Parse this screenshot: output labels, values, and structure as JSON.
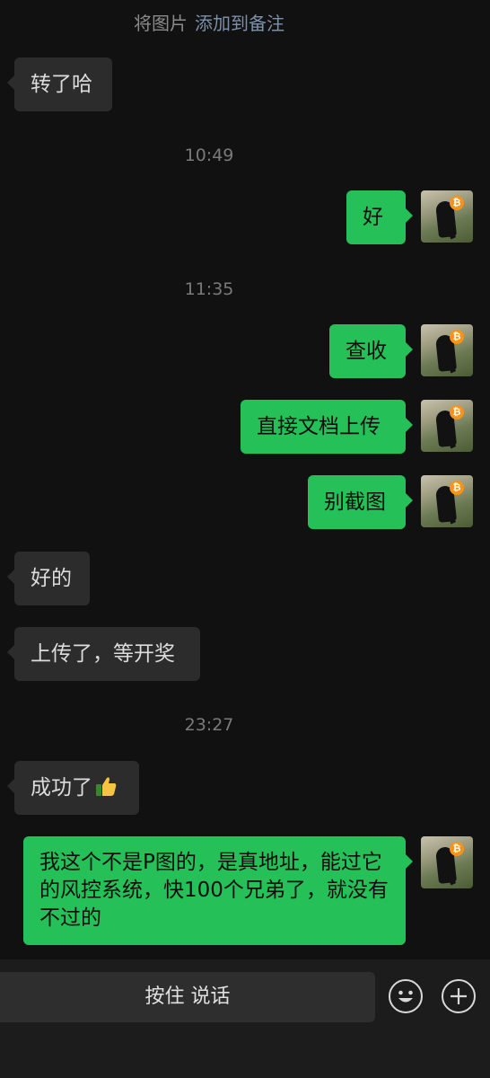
{
  "notice": {
    "text": "将图片",
    "link": "添加到备注"
  },
  "timestamps": [
    "10:49",
    "11:35",
    "23:27"
  ],
  "messages": [
    {
      "text": "转了哈"
    },
    {
      "text": "好"
    },
    {
      "text": "查收"
    },
    {
      "text": "直接文档上传"
    },
    {
      "text": "别截图"
    },
    {
      "text": "好的"
    },
    {
      "text": "上传了，等开奖"
    },
    {
      "text": "成功了"
    },
    {
      "text": "我这个不是P图的，是真地址，能过它的风控系统，快100个兄弟了，就没有不过的"
    }
  ],
  "avatar": {
    "badge": "₿",
    "badge_color": "#f7931a"
  },
  "input_bar": {
    "hold_to_talk": "按住 说话",
    "emoji_icon": "emoji-icon",
    "plus_icon": "plus-icon"
  },
  "colors": {
    "background": "#111111",
    "sent_bubble": "#25c158",
    "received_bubble": "#2c2c2c"
  }
}
